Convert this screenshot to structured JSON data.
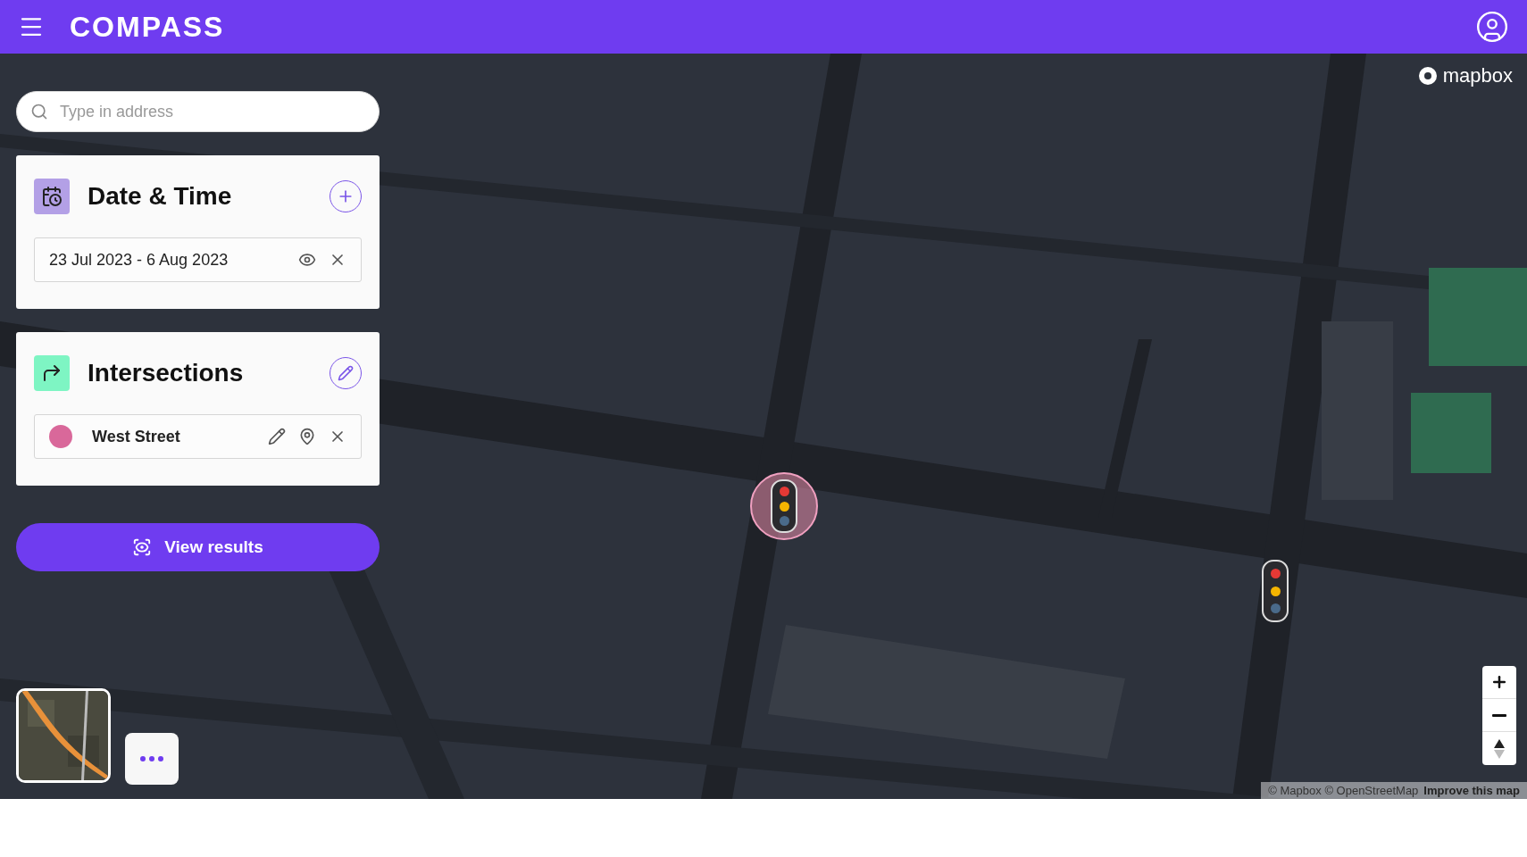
{
  "header": {
    "logo": "COMPASS"
  },
  "search": {
    "placeholder": "Type in address"
  },
  "date_time": {
    "title": "Date & Time",
    "range": "23 Jul 2023 - 6 Aug 2023"
  },
  "intersections": {
    "title": "Intersections",
    "items": [
      {
        "name": "West Street",
        "color": "#d9689a"
      }
    ]
  },
  "view_results": {
    "label": "View results"
  },
  "map": {
    "brand": "mapbox",
    "attribution": "© Mapbox © OpenStreetMap",
    "improve_link": "Improve this map",
    "markers": [
      {
        "selected": true
      },
      {
        "selected": false
      }
    ]
  }
}
